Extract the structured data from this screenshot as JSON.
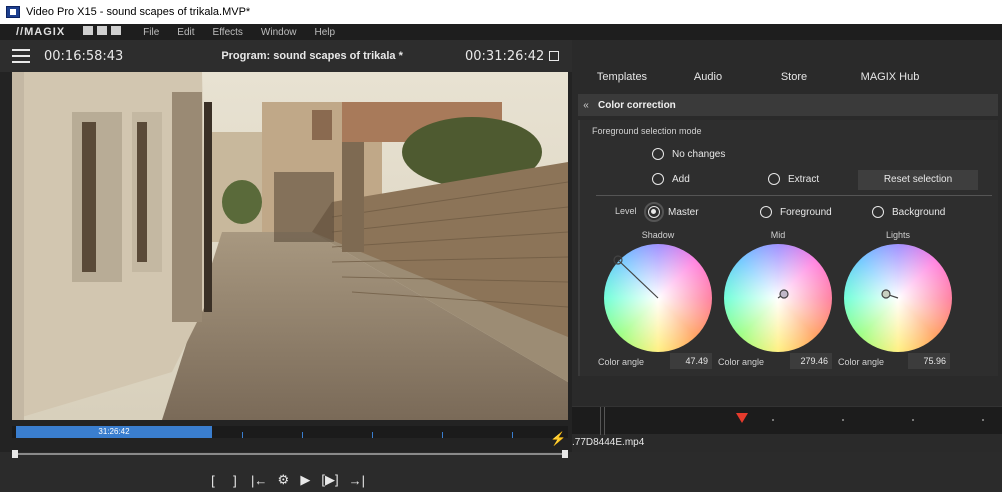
{
  "window": {
    "title": "Video Pro X15 - sound scapes of trikala.MVP*",
    "accent": "#3a7ecf"
  },
  "menu": {
    "logo": "//MAGIX",
    "items": [
      "File",
      "Edit",
      "Effects",
      "Window",
      "Help"
    ]
  },
  "program": {
    "left_timecode": "00:16:58:43",
    "title": "Program: sound scapes of trikala *",
    "right_timecode": "00:31:26:42"
  },
  "mini_timeline": {
    "label": "31:26:42"
  },
  "transport": {
    "buttons": [
      "[",
      "]",
      "|←",
      "⚙",
      "▶",
      "[▶]",
      "→|"
    ]
  },
  "tabs": [
    "Templates",
    "Audio",
    "Store",
    "MAGIX Hub"
  ],
  "color_correction": {
    "header": "Color correction",
    "fg_mode_label": "Foreground selection mode",
    "opt_no_changes": "No changes",
    "opt_add": "Add",
    "opt_extract": "Extract",
    "reset": "Reset selection",
    "level_label": "Level",
    "level_master": "Master",
    "level_foreground": "Foreground",
    "level_background": "Background",
    "wheels": [
      {
        "label": "Shadow",
        "angle_label": "Color angle",
        "angle": "47.49"
      },
      {
        "label": "Mid",
        "angle_label": "Color angle",
        "angle": "279.46"
      },
      {
        "label": "Lights",
        "angle_label": "Color angle",
        "angle": "75.96"
      }
    ]
  },
  "bottom_file": ".77D8444E.mp4",
  "icons": [
    "hamburger-icon",
    "maximize-icon",
    "double-chevron-left-icon",
    "lightning-icon"
  ]
}
